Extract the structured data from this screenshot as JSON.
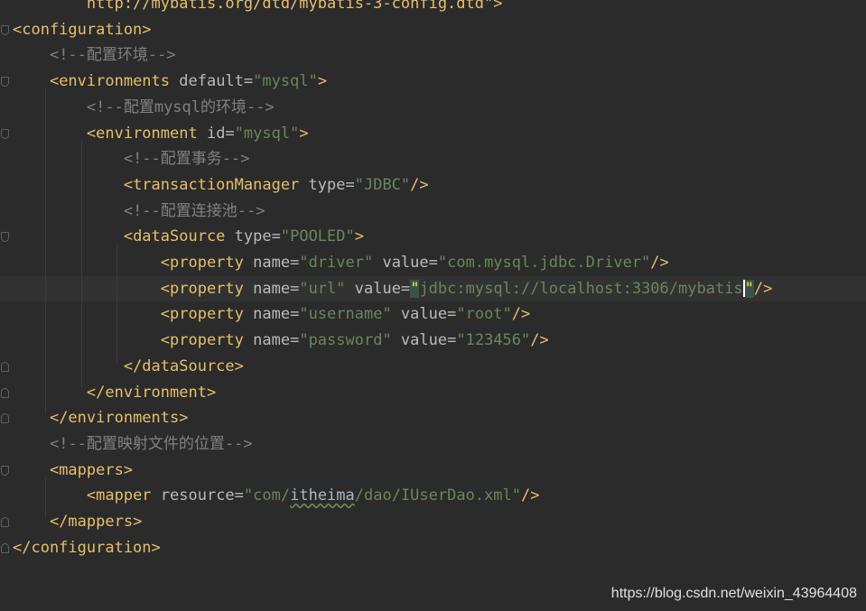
{
  "editor": {
    "lines": [
      {
        "indent": "        ",
        "parts": [
          {
            "t": "url",
            "v": "http://mybatis.org/dtd/mybatis-3-config.dtd"
          },
          {
            "t": "punct",
            "v": "\">"
          }
        ]
      },
      {
        "indent": "",
        "parts": [
          {
            "t": "tag",
            "v": "<configuration>"
          }
        ]
      },
      {
        "indent": "    ",
        "parts": [
          {
            "t": "cmt",
            "v": "<!--配置环境-->"
          }
        ]
      },
      {
        "indent": "    ",
        "parts": [
          {
            "t": "tag",
            "v": "<environments "
          },
          {
            "t": "attr",
            "v": "default"
          },
          {
            "t": "attr",
            "v": "="
          },
          {
            "t": "val",
            "v": "\"mysql\""
          },
          {
            "t": "tag",
            "v": ">"
          }
        ]
      },
      {
        "indent": "        ",
        "parts": [
          {
            "t": "cmt",
            "v": "<!--配置mysql的环境-->"
          }
        ]
      },
      {
        "indent": "        ",
        "parts": [
          {
            "t": "tag",
            "v": "<environment "
          },
          {
            "t": "attr",
            "v": "id"
          },
          {
            "t": "attr",
            "v": "="
          },
          {
            "t": "val",
            "v": "\"mysql\""
          },
          {
            "t": "tag",
            "v": ">"
          }
        ]
      },
      {
        "indent": "            ",
        "parts": [
          {
            "t": "cmt",
            "v": "<!--配置事务-->"
          }
        ]
      },
      {
        "indent": "            ",
        "parts": [
          {
            "t": "tag",
            "v": "<transactionManager "
          },
          {
            "t": "attr",
            "v": "type"
          },
          {
            "t": "attr",
            "v": "="
          },
          {
            "t": "val",
            "v": "\"JDBC\""
          },
          {
            "t": "tag",
            "v": "/>"
          }
        ]
      },
      {
        "indent": "            ",
        "parts": [
          {
            "t": "cmt",
            "v": "<!--配置连接池-->"
          }
        ]
      },
      {
        "indent": "            ",
        "parts": [
          {
            "t": "tag",
            "v": "<dataSource "
          },
          {
            "t": "attr",
            "v": "type"
          },
          {
            "t": "attr",
            "v": "="
          },
          {
            "t": "val",
            "v": "\"POOLED\""
          },
          {
            "t": "tag",
            "v": ">"
          }
        ]
      },
      {
        "indent": "                ",
        "parts": [
          {
            "t": "tag",
            "v": "<property "
          },
          {
            "t": "attr",
            "v": "name"
          },
          {
            "t": "attr",
            "v": "="
          },
          {
            "t": "val",
            "v": "\"driver\" "
          },
          {
            "t": "attr",
            "v": "value"
          },
          {
            "t": "attr",
            "v": "="
          },
          {
            "t": "val",
            "v": "\"com.mysql.jdbc.Driver\""
          },
          {
            "t": "tag",
            "v": "/>"
          }
        ]
      },
      {
        "indent": "                ",
        "current": true,
        "parts": [
          {
            "t": "tag",
            "v": "<property "
          },
          {
            "t": "attr",
            "v": "name"
          },
          {
            "t": "attr",
            "v": "="
          },
          {
            "t": "val",
            "v": "\"url\" "
          },
          {
            "t": "attr",
            "v": "value"
          },
          {
            "t": "attr",
            "v": "="
          },
          {
            "t": "match",
            "v": "\""
          },
          {
            "t": "val",
            "v": "jdbc:mysql://localhost:3306/mybatis"
          },
          {
            "t": "caret",
            "v": ""
          },
          {
            "t": "match",
            "v": "\""
          },
          {
            "t": "tag",
            "v": "/>"
          }
        ]
      },
      {
        "indent": "                ",
        "parts": [
          {
            "t": "tag",
            "v": "<property "
          },
          {
            "t": "attr",
            "v": "name"
          },
          {
            "t": "attr",
            "v": "="
          },
          {
            "t": "val",
            "v": "\"username\" "
          },
          {
            "t": "attr",
            "v": "value"
          },
          {
            "t": "attr",
            "v": "="
          },
          {
            "t": "val",
            "v": "\"root\""
          },
          {
            "t": "tag",
            "v": "/>"
          }
        ]
      },
      {
        "indent": "                ",
        "parts": [
          {
            "t": "tag",
            "v": "<property "
          },
          {
            "t": "attr",
            "v": "name"
          },
          {
            "t": "attr",
            "v": "="
          },
          {
            "t": "val",
            "v": "\"password\" "
          },
          {
            "t": "attr",
            "v": "value"
          },
          {
            "t": "attr",
            "v": "="
          },
          {
            "t": "val",
            "v": "\"123456\""
          },
          {
            "t": "tag",
            "v": "/>"
          }
        ]
      },
      {
        "indent": "            ",
        "parts": [
          {
            "t": "tag",
            "v": "</dataSource>"
          }
        ]
      },
      {
        "indent": "        ",
        "parts": [
          {
            "t": "tag",
            "v": "</environment>"
          }
        ]
      },
      {
        "indent": "    ",
        "parts": [
          {
            "t": "tag",
            "v": "</environments>"
          }
        ]
      },
      {
        "indent": "    ",
        "parts": [
          {
            "t": "cmt",
            "v": "<!--配置映射文件的位置-->"
          }
        ]
      },
      {
        "indent": "    ",
        "parts": [
          {
            "t": "tag",
            "v": "<mappers>"
          }
        ]
      },
      {
        "indent": "        ",
        "parts": [
          {
            "t": "tag",
            "v": "<mapper "
          },
          {
            "t": "attr",
            "v": "resource"
          },
          {
            "t": "attr",
            "v": "="
          },
          {
            "t": "val",
            "v": "\"com/"
          },
          {
            "t": "squiggle",
            "v": "itheima"
          },
          {
            "t": "val",
            "v": "/dao/IUserDao.xml\""
          },
          {
            "t": "tag",
            "v": "/>"
          }
        ]
      },
      {
        "indent": "    ",
        "parts": [
          {
            "t": "tag",
            "v": "</mappers>"
          }
        ]
      },
      {
        "indent": "",
        "parts": [
          {
            "t": "tag",
            "v": "</configuration>"
          }
        ]
      }
    ]
  },
  "watermark": {
    "text": "https://blog.csdn.net/weixin_43964408"
  },
  "colors": {
    "background": "#2b2b2b",
    "tag": "#e8bf6a",
    "attribute": "#bababa",
    "value": "#6a8759",
    "comment": "#808080",
    "current_line": "#323232"
  }
}
